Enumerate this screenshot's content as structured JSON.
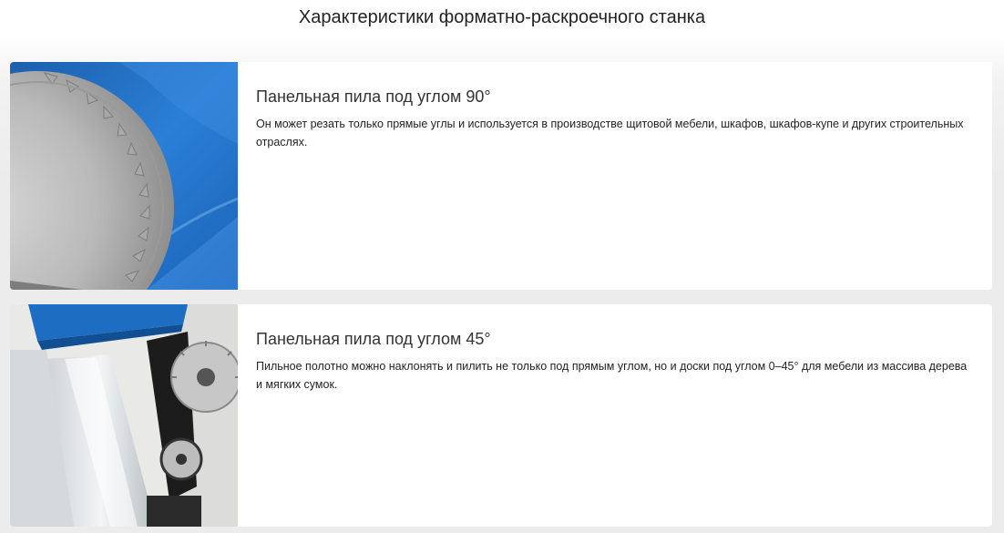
{
  "page": {
    "title": "Характеристики форматно-раскроечного станка"
  },
  "cards": [
    {
      "heading": "Панельная пила под углом 90°",
      "text": "Он может резать только прямые углы и используется в производстве щитовой мебели, шкафов, шкафов-купе и других строительных отраслях.",
      "image": "saw-blade-blue-photo"
    },
    {
      "heading": "Панельная пила под углом 45°",
      "text": "Пильное полотно можно наклонять и пилить не только под прямым углом, но и доски под углом 0–45° для мебели из массива дерева и мягких сумок.",
      "image": "tilted-saw-machine-photo"
    }
  ],
  "colors": {
    "background": "#ececec",
    "card": "#ffffff",
    "accent_blue": "#1f6fc4"
  }
}
